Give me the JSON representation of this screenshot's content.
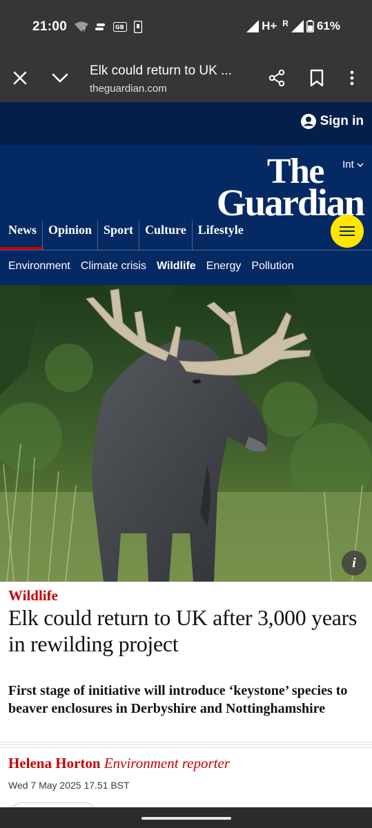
{
  "status_bar": {
    "time": "21:00",
    "network": "H+",
    "roaming": "R",
    "battery": "61%"
  },
  "browser": {
    "tab_title": "Elk could return to UK ...",
    "url": "theguardian.com",
    "icons": [
      "close-icon",
      "chevron-down-icon",
      "share-icon",
      "bookmark-icon",
      "more-vert-icon"
    ]
  },
  "header": {
    "sign_in": "Sign in",
    "edition": "Int",
    "logo_line1": "The",
    "logo_line2": "Guardian",
    "pillars": [
      {
        "label": "News",
        "active": true
      },
      {
        "label": "Opinion"
      },
      {
        "label": "Sport"
      },
      {
        "label": "Culture"
      },
      {
        "label": "Lifestyle"
      }
    ],
    "subnav": [
      "Environment",
      "Climate crisis",
      "Wildlife",
      "Energy",
      "Pollution"
    ],
    "subnav_current": "Wildlife"
  },
  "hero": {
    "info_label": "i"
  },
  "article": {
    "kicker": "Wildlife",
    "headline": "Elk could return to UK after 3,000 years in rewilding project",
    "standfirst": "First stage of initiative will introduce ‘keystone’ species to beaver enclosures in Derbyshire and Nottinghamshire",
    "author": "Helena Horton",
    "author_role": "Environment reporter",
    "date": "Wed 7 May 2025 17.51 BST"
  },
  "colors": {
    "brand_blue": "#052962",
    "brand_dark": "#041f4a",
    "accent_red": "#c70000",
    "menu_yellow": "#ffe500"
  }
}
